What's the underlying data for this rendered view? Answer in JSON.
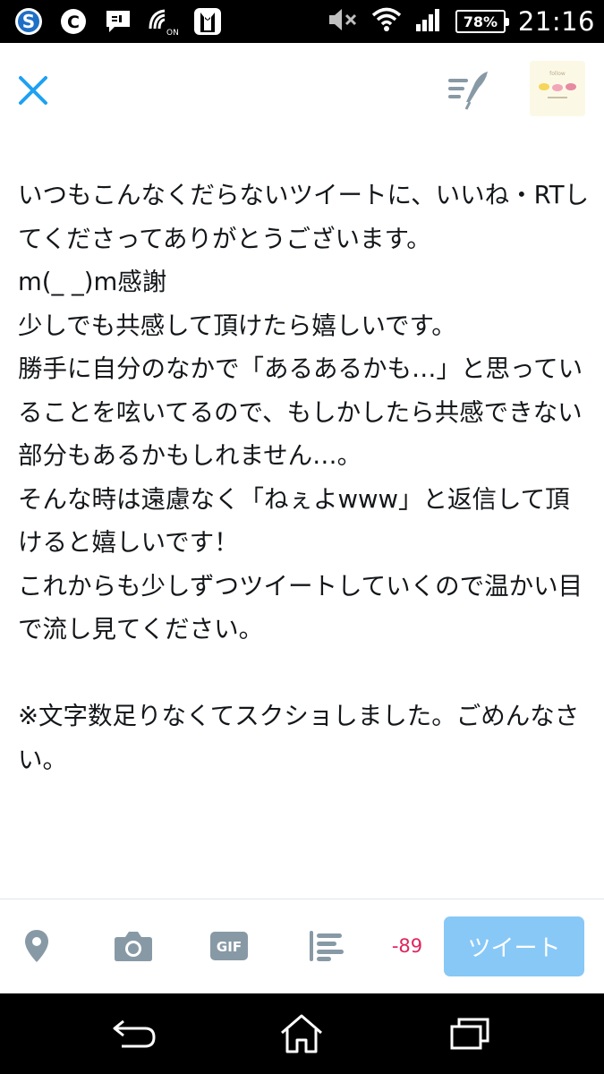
{
  "status_bar": {
    "battery": "78%",
    "time": "21:16",
    "left_icons": [
      "s-app-icon",
      "c-app-icon",
      "message-icon",
      "nfc-on-icon",
      "tuxedo-app-icon"
    ],
    "right_icons": [
      "mute-icon",
      "wifi-icon",
      "signal-icon"
    ]
  },
  "header": {
    "close_icon": "close-icon",
    "drafts_icon": "drafts-icon",
    "avatar_caption": "follow"
  },
  "tweet": {
    "text": "いつもこんなくだらないツイートに、いいね・RTしてくださってありがとうございます。\nm(_ _)m感謝\n少しでも共感して頂けたら嬉しいです。\n勝手に自分のなかで「あるあるかも…」と思っていることを呟いてるので、もしかしたら共感できない部分もあるかもしれません…。\nそんな時は遠慮なく「ねぇよwww」と返信して頂けると嬉しいです！\nこれからも少しずつツイートしていくので温かい目で流し見てください。\n\n※文字数足りなくてスクショしました。ごめんなさい。"
  },
  "toolbar": {
    "gif_label": "GIF",
    "char_count": "-89",
    "tweet_button": "ツイート"
  },
  "colors": {
    "accent": "#1da1f2",
    "tweet_button_bg": "#88c8f7",
    "icon_gray": "#8899a6",
    "counter_red": "#e0245e"
  }
}
